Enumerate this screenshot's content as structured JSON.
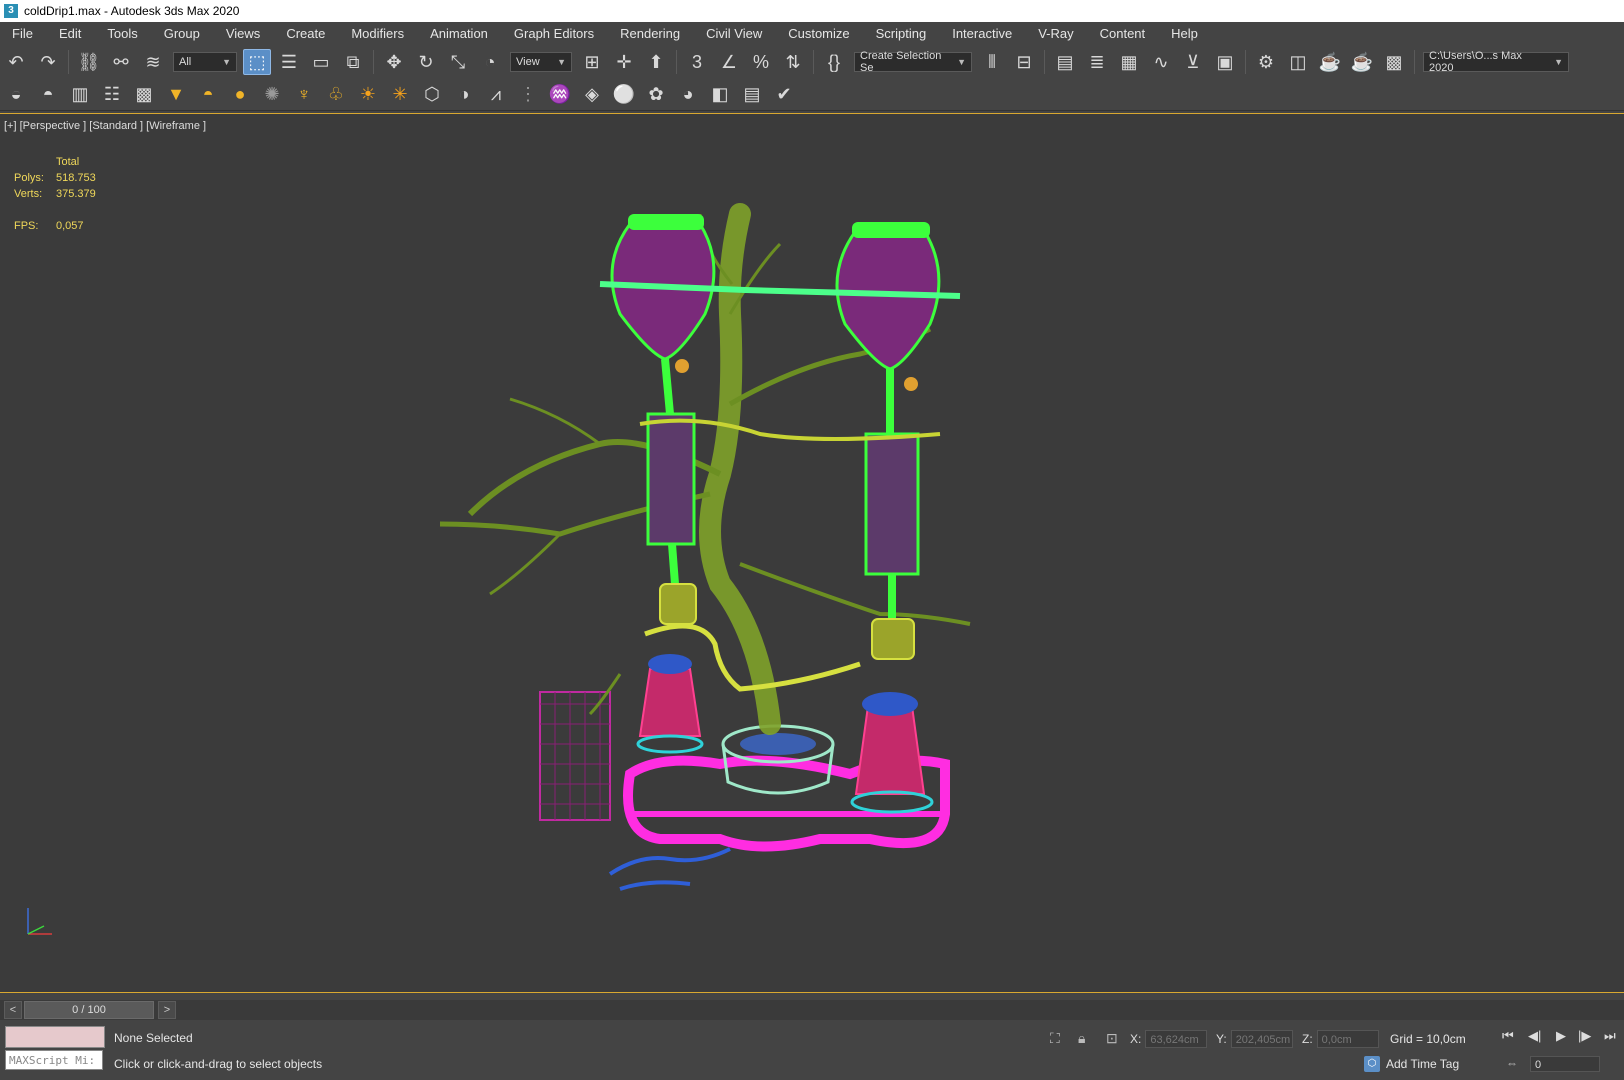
{
  "window": {
    "title": "coldDrip1.max - Autodesk 3ds Max 2020",
    "icon": "3"
  },
  "menu": [
    "File",
    "Edit",
    "Tools",
    "Group",
    "Views",
    "Create",
    "Modifiers",
    "Animation",
    "Graph Editors",
    "Rendering",
    "Civil View",
    "Customize",
    "Scripting",
    "Interactive",
    "V-Ray",
    "Content",
    "Help"
  ],
  "toolbar": {
    "selection_filter": "All",
    "ref_coord": "View",
    "named_selection": "Create Selection Se",
    "project_path": "C:\\Users\\O...s Max 2020"
  },
  "viewport": {
    "label": "[+] [Perspective ] [Standard ] [Wireframe ]",
    "stats": {
      "header": "Total",
      "polys_label": "Polys:",
      "polys": "518.753",
      "verts_label": "Verts:",
      "verts": "375.379",
      "fps_label": "FPS:",
      "fps": "0,057"
    }
  },
  "timeline": {
    "prev": "<",
    "next": ">",
    "frame": "0 / 100"
  },
  "status": {
    "maxscript": "MAXScript Mi:",
    "selection": "None Selected",
    "prompt": "Click or click-and-drag to select objects",
    "x_label": "X:",
    "x": "63,624cm",
    "y_label": "Y:",
    "y": "202,405cm",
    "z_label": "Z:",
    "z": "0,0cm",
    "grid": "Grid = 10,0cm",
    "add_time_tag": "Add Time Tag",
    "current_frame": "0"
  },
  "colors": {
    "accent": "#5b8fc7",
    "viewport_border": "#d9a830",
    "stats_text": "#f0d85a"
  }
}
